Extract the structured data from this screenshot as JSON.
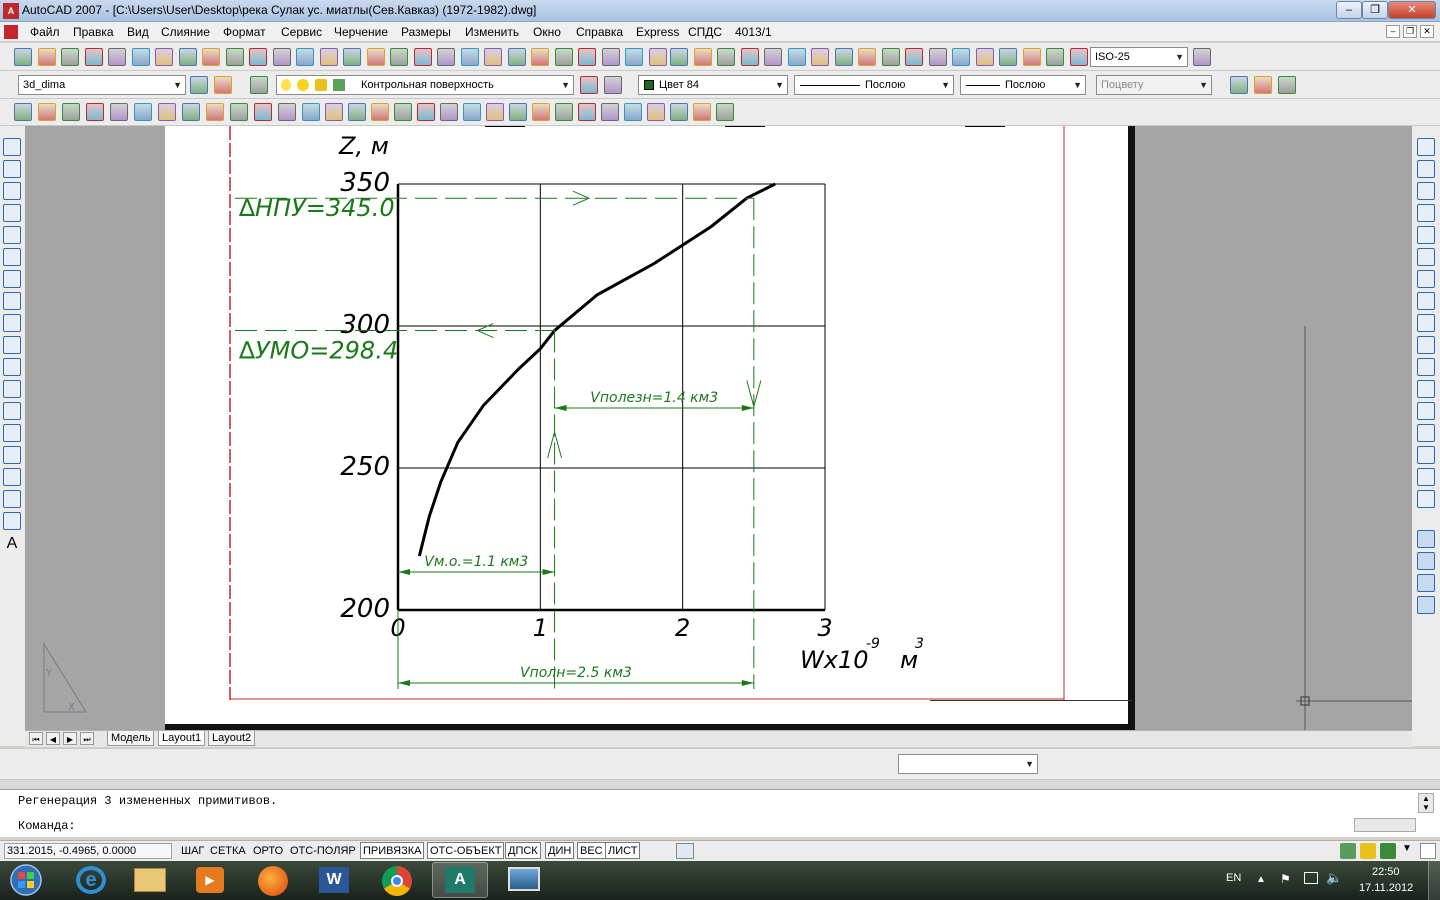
{
  "window": {
    "title": "AutoCAD 2007 - [C:\\Users\\User\\Desktop\\река Сулак ус. миатлы(Сев.Кавказ) (1972-1982).dwg]",
    "app_icon_text": "A"
  },
  "menu": [
    "Файл",
    "Правка",
    "Вид",
    "Слияние",
    "Формат",
    "Сервис",
    "Черчение",
    "Размеры",
    "Изменить",
    "Окно",
    "Справка",
    "Express",
    "СПДС",
    "4013/1"
  ],
  "toolbar": {
    "dimstyle": "ISO-25",
    "workspace": "3d_dima",
    "layer": "Контрольная поверхность",
    "color": "Цвет 84",
    "linetype": "Послою",
    "lineweight": "Послою",
    "plotstyle": "Поцвету"
  },
  "colors": {
    "accent_green": "#1a7a1a",
    "frame_red": "#c0282d",
    "chart_line": "#000000"
  },
  "chart_data": {
    "type": "line",
    "title": "",
    "ylabel": "Z,  м",
    "xlabel": "Wx10",
    "xlabel_exp": "-9",
    "xunit": "м",
    "xunit_exp": "3",
    "xlim": [
      0,
      3
    ],
    "ylim": [
      200,
      350
    ],
    "x_ticks": [
      "0",
      "1",
      "2",
      "3"
    ],
    "y_ticks": [
      "200",
      "250",
      "300",
      "350"
    ],
    "grid": true,
    "series": [
      {
        "x": [
          0.15,
          0.22,
          0.3,
          0.42,
          0.6,
          0.85,
          1.0,
          1.1,
          1.4,
          1.8,
          2.2,
          2.45,
          2.65
        ],
        "y": [
          219,
          233,
          245,
          259,
          272,
          285,
          292,
          298.4,
          311,
          322,
          335,
          345,
          350
        ]
      }
    ],
    "annotations": {
      "nru_label": "∆НПУ=345.0",
      "nru_level": 345.0,
      "umo_label": "∆УМО=298.4",
      "umo_level": 298.4,
      "v_mo_label": "Vм.о.=1.1  км3",
      "v_mo": 1.1,
      "v_useful_label": "Vполезн=1.4  км3",
      "v_full_label": "Vполн=2.5  км3",
      "v_full": 2.5
    }
  },
  "layout_tabs": [
    "Модель",
    "Layout1",
    "Layout2"
  ],
  "active_tab": "Layout1",
  "command": {
    "history": "Регенерация 3 измененных примитивов.",
    "prompt": "Команда:"
  },
  "status": {
    "coordinates": "331.2015, -0.4965, 0.0000",
    "toggles": [
      "ШАГ",
      "СЕТКА",
      "ОРТО",
      "ОТС-ПОЛЯР",
      "ПРИВЯЗКА",
      "ОТС-ОБЪЕКТ",
      "ДПСК",
      "ДИН",
      "ВЕС",
      "ЛИСТ"
    ],
    "toggles_on": [
      "ПРИВЯЗКА",
      "ОТС-ОБЪЕКТ",
      "ДПСК",
      "ДИН",
      "ВЕС",
      "ЛИСТ"
    ]
  },
  "taskbar": {
    "language": "EN",
    "time": "22:50",
    "date": "17.11.2012"
  }
}
